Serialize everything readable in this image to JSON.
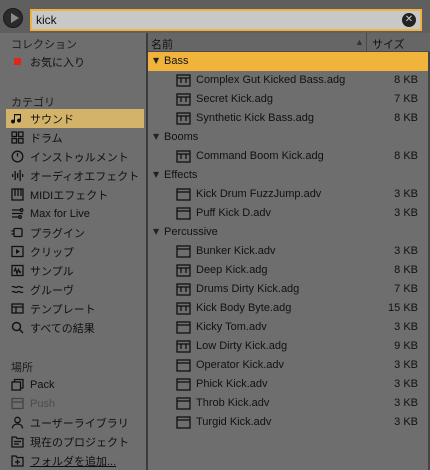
{
  "search": {
    "value": "kick"
  },
  "sidebar": {
    "collections_header": "コレクション",
    "favorites": "お気に入り",
    "categories_header": "カテゴリ",
    "categories": [
      {
        "label": "サウンド",
        "icon": "note-icon",
        "selected": true
      },
      {
        "label": "ドラム",
        "icon": "drum-grid-icon"
      },
      {
        "label": "インストゥルメント",
        "icon": "clock-icon"
      },
      {
        "label": "オーディオエフェクト",
        "icon": "audio-fx-icon"
      },
      {
        "label": "MIDIエフェクト",
        "icon": "midi-icon"
      },
      {
        "label": "Max for Live",
        "icon": "max-icon"
      },
      {
        "label": "プラグイン",
        "icon": "plugin-icon"
      },
      {
        "label": "クリップ",
        "icon": "clip-icon"
      },
      {
        "label": "サンプル",
        "icon": "sample-icon"
      },
      {
        "label": "グルーヴ",
        "icon": "groove-icon"
      },
      {
        "label": "テンプレート",
        "icon": "template-icon"
      },
      {
        "label": "すべての結果",
        "icon": "search-icon"
      }
    ],
    "places_header": "場所",
    "places": [
      {
        "label": "Pack",
        "icon": "pack-icon"
      },
      {
        "label": "Push",
        "icon": "push-icon",
        "dim": true
      },
      {
        "label": "ユーザーライブラリ",
        "icon": "user-icon"
      },
      {
        "label": "現在のプロジェクト",
        "icon": "project-icon"
      },
      {
        "label": "フォルダを追加...",
        "icon": "add-folder-icon"
      }
    ]
  },
  "columns": {
    "name": "名前",
    "size": "サイズ"
  },
  "results": [
    {
      "type": "folder",
      "name": "Bass",
      "open": true
    },
    {
      "type": "file",
      "name": "Complex Gut Kicked Bass.adg",
      "size": "8 KB",
      "icon": "preset-icon"
    },
    {
      "type": "file",
      "name": "Secret Kick.adg",
      "size": "7 KB",
      "icon": "preset-icon"
    },
    {
      "type": "file",
      "name": "Synthetic Kick Bass.adg",
      "size": "8 KB",
      "icon": "preset-icon"
    },
    {
      "type": "folder",
      "name": "Booms"
    },
    {
      "type": "file",
      "name": "Command Boom Kick.adg",
      "size": "8 KB",
      "icon": "preset-icon"
    },
    {
      "type": "folder",
      "name": "Effects"
    },
    {
      "type": "file",
      "name": "Kick Drum FuzzJump.adv",
      "size": "3 KB",
      "icon": "device-icon"
    },
    {
      "type": "file",
      "name": "Puff Kick D.adv",
      "size": "3 KB",
      "icon": "device-icon"
    },
    {
      "type": "folder",
      "name": "Percussive"
    },
    {
      "type": "file",
      "name": "Bunker Kick.adv",
      "size": "3 KB",
      "icon": "device-icon"
    },
    {
      "type": "file",
      "name": "Deep Kick.adg",
      "size": "8 KB",
      "icon": "preset-icon"
    },
    {
      "type": "file",
      "name": "Drums Dirty Kick.adg",
      "size": "7 KB",
      "icon": "preset-icon"
    },
    {
      "type": "file",
      "name": "Kick Body Byte.adg",
      "size": "15 KB",
      "icon": "preset-icon"
    },
    {
      "type": "file",
      "name": "Kicky Tom.adv",
      "size": "3 KB",
      "icon": "device-icon"
    },
    {
      "type": "file",
      "name": "Low Dirty Kick.adg",
      "size": "9 KB",
      "icon": "preset-icon"
    },
    {
      "type": "file",
      "name": "Operator Kick.adv",
      "size": "3 KB",
      "icon": "device-icon"
    },
    {
      "type": "file",
      "name": "Phick Kick.adv",
      "size": "3 KB",
      "icon": "device-icon"
    },
    {
      "type": "file",
      "name": "Throb Kick.adv",
      "size": "3 KB",
      "icon": "device-icon"
    },
    {
      "type": "file",
      "name": "Turgid Kick.adv",
      "size": "3 KB",
      "icon": "device-icon"
    }
  ],
  "colors": {
    "accent": "#f0b43c",
    "selected": "#d3b36a",
    "favorite": "#e0251b",
    "background": "#6e6e6e"
  }
}
